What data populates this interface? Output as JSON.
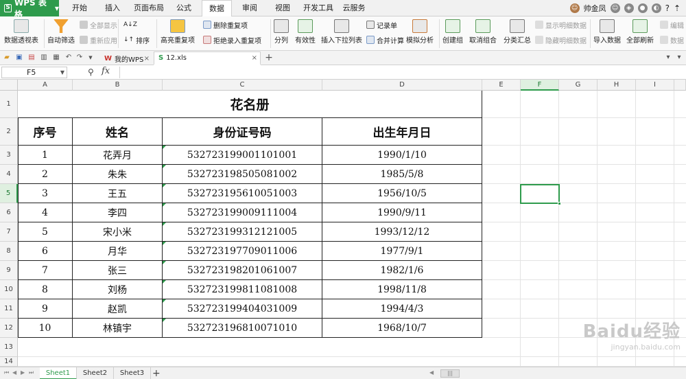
{
  "app": {
    "logo_text": "WPS 表格",
    "menu_tabs": [
      "开始",
      "插入",
      "页面布局",
      "公式",
      "数据",
      "审阅",
      "视图",
      "开发工具",
      "云服务"
    ],
    "active_menu": "数据",
    "user_name": "帅金凤"
  },
  "ribbon": {
    "pivot": "数据透视表",
    "autofilter": "自动筛选",
    "show_all": "全部显示",
    "reapply": "重新应用",
    "sort": "排序",
    "highlight_dup": "高亮重复项",
    "delete_dup": "删除重复项",
    "reject_dup": "拒绝录入重复项",
    "split": "分列",
    "validity": "有效性",
    "insert_dropdown": "插入下拉列表",
    "record_form": "记录单",
    "merge_calc": "合并计算",
    "simulate": "模拟分析",
    "group": "创建组",
    "ungroup": "取消组合",
    "subtotal": "分类汇总",
    "show_detail": "显示明细数据",
    "hide_detail": "隐藏明细数据",
    "import": "导入数据",
    "refresh_all": "全部刷新",
    "edit_link": "编辑",
    "data_link": "数据"
  },
  "doc_tabs": [
    {
      "label": "我的WPS"
    },
    {
      "label": "12.xls"
    }
  ],
  "formula_bar": {
    "name_box": "F5",
    "formula": ""
  },
  "columns": [
    "A",
    "B",
    "C",
    "D",
    "E",
    "F",
    "G",
    "H",
    "I"
  ],
  "rows": [
    "1",
    "2",
    "3",
    "4",
    "5",
    "6",
    "7",
    "8",
    "9",
    "10",
    "11",
    "12",
    "13",
    "14"
  ],
  "sheet": {
    "title": "花名册",
    "headers": [
      "序号",
      "姓名",
      "身份证号码",
      "出生年月日"
    ],
    "records": [
      [
        "1",
        "花弄月",
        "532723199001101001",
        "1990/1/10"
      ],
      [
        "2",
        "朱朱",
        "532723198505081002",
        "1985/5/8"
      ],
      [
        "3",
        "王五",
        "532723195610051003",
        "1956/10/5"
      ],
      [
        "4",
        "李四",
        "532723199009111004",
        "1990/9/11"
      ],
      [
        "5",
        "宋小米",
        "532723199312121005",
        "1993/12/12"
      ],
      [
        "6",
        "月华",
        "532723197709011006",
        "1977/9/1"
      ],
      [
        "7",
        "张三",
        "532723198201061007",
        "1982/1/6"
      ],
      [
        "8",
        "刘杨",
        "532723199811081008",
        "1998/11/8"
      ],
      [
        "9",
        "赵凯",
        "532723199404031009",
        "1994/4/3"
      ],
      [
        "10",
        "林镇宇",
        "532723196810071010",
        "1968/10/7"
      ]
    ]
  },
  "sheet_tabs": [
    "Sheet1",
    "Sheet2",
    "Sheet3"
  ],
  "active_sheet": "Sheet1",
  "watermark": {
    "main": "Baidu经验",
    "sub": "jingyan.baidu.com"
  },
  "colors": {
    "accent": "#2e9b4c",
    "wps_logo": "#2e9b4c",
    "selection": "#2e9b4c"
  }
}
